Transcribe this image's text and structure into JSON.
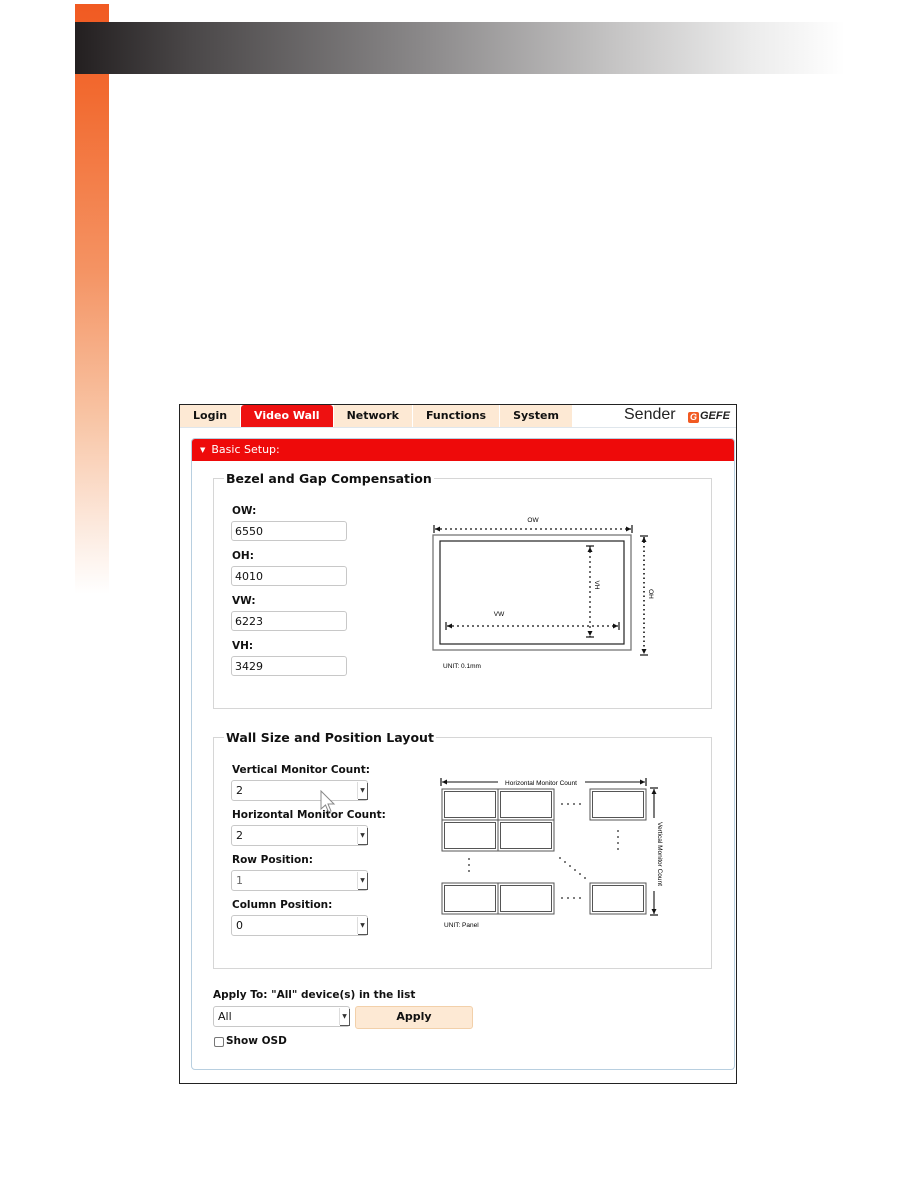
{
  "page": {
    "accent_orange": "#f15a22",
    "header_dark": "#231f20"
  },
  "tabs": [
    {
      "label": "Login",
      "active": false
    },
    {
      "label": "Video Wall",
      "active": true
    },
    {
      "label": "Network",
      "active": false
    },
    {
      "label": "Functions",
      "active": false
    },
    {
      "label": "System",
      "active": false
    }
  ],
  "header": {
    "device_role": "Sender",
    "logo_text": "GEFE",
    "logo_icon": "gefen-g-logo-icon"
  },
  "panel": {
    "title": "Basic Setup:",
    "title_color": "#ee0a0a",
    "expand_icon": "triangle-down-icon"
  },
  "bezel": {
    "title": "Bezel and Gap Compensation",
    "fields": [
      {
        "label": "OW:",
        "value": "6550"
      },
      {
        "label": "OH:",
        "value": "4010"
      },
      {
        "label": "VW:",
        "value": "6223"
      },
      {
        "label": "VH:",
        "value": "3429"
      }
    ],
    "diagram": {
      "ow_label": "OW",
      "oh_label": "OH",
      "vw_label": "VW",
      "vh_label": "VH",
      "unit": "UNIT: 0.1mm"
    }
  },
  "wall": {
    "title": "Wall Size and Position Layout",
    "selects": [
      {
        "label": "Vertical Monitor Count:",
        "value": "2",
        "disabled": false
      },
      {
        "label": "Horizontal Monitor Count:",
        "value": "2",
        "disabled": false
      },
      {
        "label": "Row Position:",
        "value": "1",
        "disabled": true
      },
      {
        "label": "Column Position:",
        "value": "0",
        "disabled": false
      }
    ],
    "diagram": {
      "h_label": "Horizontal Monitor Count",
      "v_label": "Vertical Monitor Count",
      "unit": "UNIT: Panel"
    }
  },
  "apply": {
    "label": "Apply To: \"All\" device(s) in the list",
    "select_value": "All",
    "button_label": "Apply",
    "show_osd_label": "Show OSD",
    "show_osd_checked": false
  }
}
